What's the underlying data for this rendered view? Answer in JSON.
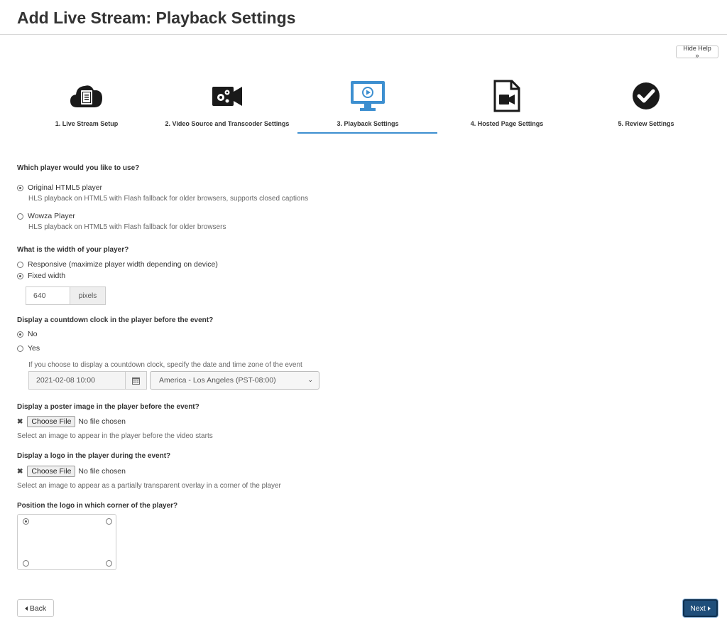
{
  "page": {
    "title": "Add Live Stream: Playback Settings"
  },
  "help": {
    "hide_label": "Hide Help »"
  },
  "steps": [
    {
      "label": "1. Live Stream Setup",
      "icon": "cloud-document-icon"
    },
    {
      "label": "2. Video Source and Transcoder Settings",
      "icon": "video-camera-gear-icon"
    },
    {
      "label": "3. Playback Settings",
      "icon": "monitor-play-icon",
      "active": true
    },
    {
      "label": "4. Hosted Page Settings",
      "icon": "video-file-icon"
    },
    {
      "label": "5. Review Settings",
      "icon": "checkmark-circle-icon"
    }
  ],
  "colors": {
    "active_step": "#3d8fd0",
    "primary_button": "#1f4e7a",
    "icon_dark": "#1a1a1a"
  },
  "player": {
    "question": "Which player would you like to use?",
    "options": [
      {
        "label": "Original HTML5 player",
        "description": "HLS playback on HTML5 with Flash fallback for older browsers, supports closed captions",
        "checked": true
      },
      {
        "label": "Wowza Player",
        "description": "HLS playback on HTML5 with Flash fallback for older browsers",
        "checked": false
      }
    ]
  },
  "width": {
    "question": "What is the width of your player?",
    "options": [
      {
        "label": "Responsive (maximize player width depending on device)",
        "checked": false
      },
      {
        "label": "Fixed width",
        "checked": true
      }
    ],
    "value": "640",
    "unit": "pixels"
  },
  "countdown": {
    "question": "Display a countdown clock in the player before the event?",
    "options": [
      {
        "label": "No",
        "checked": true
      },
      {
        "label": "Yes",
        "checked": false
      }
    ],
    "help": "If you choose to display a countdown clock, specify the date and time zone of the event",
    "date_value": "2021-02-08 10:00",
    "timezone": "America - Los Angeles (PST-08:00)"
  },
  "poster": {
    "question": "Display a poster image in the player before the event?",
    "button": "Choose File",
    "status": "No file chosen",
    "help": "Select an image to appear in the player before the video starts"
  },
  "logo": {
    "question": "Display a logo in the player during the event?",
    "button": "Choose File",
    "status": "No file chosen",
    "help": "Select an image to appear as a partially transparent overlay in a corner of the player"
  },
  "position": {
    "question": "Position the logo in which corner of the player?",
    "selected": "top-left"
  },
  "nav": {
    "back": "Back",
    "next": "Next"
  }
}
